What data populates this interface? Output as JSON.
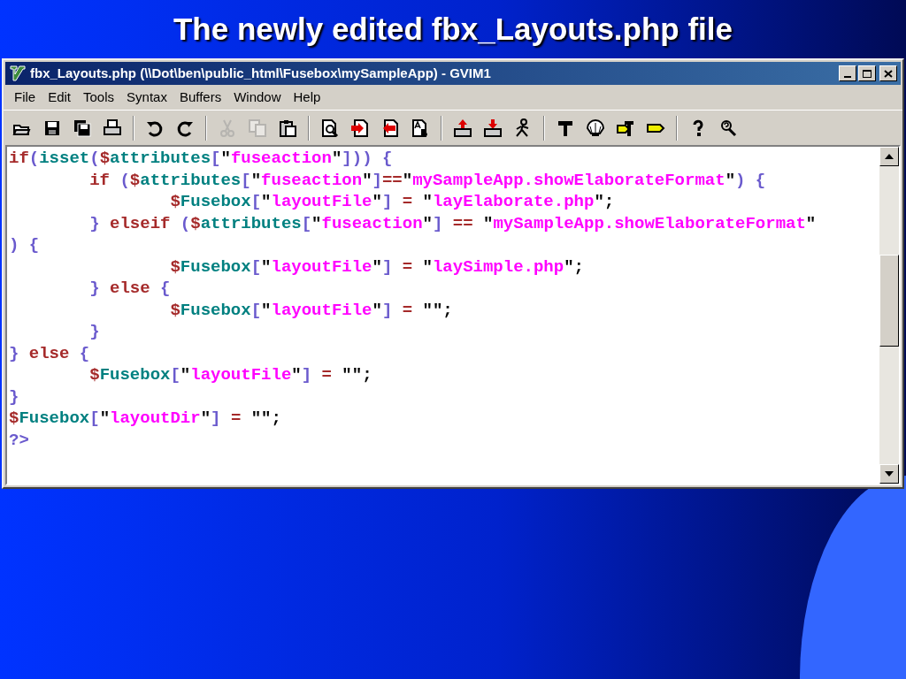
{
  "slide_title": "The newly edited fbx_Layouts.php file",
  "window": {
    "title": "fbx_Layouts.php (\\\\Dot\\ben\\public_html\\Fusebox\\mySampleApp) - GVIM1"
  },
  "menu": [
    "File",
    "Edit",
    "Tools",
    "Syntax",
    "Buffers",
    "Window",
    "Help"
  ],
  "toolbar": [
    {
      "kind": "open",
      "disabled": false
    },
    {
      "kind": "save",
      "disabled": false
    },
    {
      "kind": "saveall",
      "disabled": false
    },
    {
      "kind": "print",
      "disabled": false
    },
    {
      "kind": "sep"
    },
    {
      "kind": "undo",
      "disabled": false
    },
    {
      "kind": "redo",
      "disabled": false
    },
    {
      "kind": "sep"
    },
    {
      "kind": "cut",
      "disabled": true
    },
    {
      "kind": "copy",
      "disabled": true
    },
    {
      "kind": "paste",
      "disabled": false
    },
    {
      "kind": "sep"
    },
    {
      "kind": "find",
      "disabled": false
    },
    {
      "kind": "findnext",
      "disabled": false
    },
    {
      "kind": "findprev",
      "disabled": false
    },
    {
      "kind": "replace",
      "disabled": false
    },
    {
      "kind": "sep"
    },
    {
      "kind": "load",
      "disabled": false
    },
    {
      "kind": "store",
      "disabled": false
    },
    {
      "kind": "run",
      "disabled": false
    },
    {
      "kind": "sep"
    },
    {
      "kind": "make",
      "disabled": false
    },
    {
      "kind": "shell",
      "disabled": false
    },
    {
      "kind": "tagjump",
      "disabled": false
    },
    {
      "kind": "tag",
      "disabled": false
    },
    {
      "kind": "sep"
    },
    {
      "kind": "help",
      "disabled": false
    },
    {
      "kind": "findhelp",
      "disabled": false
    }
  ],
  "code": [
    [
      {
        "kind": "kw",
        "text": "if"
      },
      {
        "kind": "punct",
        "text": "("
      },
      {
        "kind": "fn",
        "text": "isset"
      },
      {
        "kind": "punct",
        "text": "("
      },
      {
        "kind": "kw",
        "text": "$"
      },
      {
        "kind": "fn",
        "text": "attributes"
      },
      {
        "kind": "punct",
        "text": "["
      },
      {
        "kind": "plain",
        "text": "\""
      },
      {
        "kind": "str",
        "text": "fuseaction"
      },
      {
        "kind": "plain",
        "text": "\""
      },
      {
        "kind": "punct",
        "text": "])) {"
      }
    ],
    [
      {
        "kind": "kw",
        "text": "\tif"
      },
      {
        "kind": "punct",
        "text": " ("
      },
      {
        "kind": "kw",
        "text": "$"
      },
      {
        "kind": "fn",
        "text": "attributes"
      },
      {
        "kind": "punct",
        "text": "["
      },
      {
        "kind": "plain",
        "text": "\""
      },
      {
        "kind": "str",
        "text": "fuseaction"
      },
      {
        "kind": "plain",
        "text": "\""
      },
      {
        "kind": "punct",
        "text": "]"
      },
      {
        "kind": "op",
        "text": "=="
      },
      {
        "kind": "plain",
        "text": "\""
      },
      {
        "kind": "str",
        "text": "mySampleApp.showElaborateFormat"
      },
      {
        "kind": "plain",
        "text": "\""
      },
      {
        "kind": "punct",
        "text": ") {"
      }
    ],
    [
      {
        "kind": "kw",
        "text": "\t\t$"
      },
      {
        "kind": "fn",
        "text": "Fusebox"
      },
      {
        "kind": "punct",
        "text": "["
      },
      {
        "kind": "plain",
        "text": "\""
      },
      {
        "kind": "str",
        "text": "layoutFile"
      },
      {
        "kind": "plain",
        "text": "\""
      },
      {
        "kind": "punct",
        "text": "]"
      },
      {
        "kind": "op",
        "text": " = "
      },
      {
        "kind": "plain",
        "text": "\""
      },
      {
        "kind": "str",
        "text": "layElaborate.php"
      },
      {
        "kind": "plain",
        "text": "\";"
      }
    ],
    [
      {
        "kind": "punct",
        "text": "\t} "
      },
      {
        "kind": "kw",
        "text": "elseif"
      },
      {
        "kind": "punct",
        "text": " ("
      },
      {
        "kind": "kw",
        "text": "$"
      },
      {
        "kind": "fn",
        "text": "attributes"
      },
      {
        "kind": "punct",
        "text": "["
      },
      {
        "kind": "plain",
        "text": "\""
      },
      {
        "kind": "str",
        "text": "fuseaction"
      },
      {
        "kind": "plain",
        "text": "\""
      },
      {
        "kind": "punct",
        "text": "]"
      },
      {
        "kind": "op",
        "text": " == "
      },
      {
        "kind": "plain",
        "text": "\""
      },
      {
        "kind": "str",
        "text": "mySampleApp.showElaborateFormat"
      },
      {
        "kind": "plain",
        "text": "\""
      }
    ],
    [
      {
        "kind": "punct",
        "text": ") {"
      }
    ],
    [
      {
        "kind": "kw",
        "text": "\t\t$"
      },
      {
        "kind": "fn",
        "text": "Fusebox"
      },
      {
        "kind": "punct",
        "text": "["
      },
      {
        "kind": "plain",
        "text": "\""
      },
      {
        "kind": "str",
        "text": "layoutFile"
      },
      {
        "kind": "plain",
        "text": "\""
      },
      {
        "kind": "punct",
        "text": "]"
      },
      {
        "kind": "op",
        "text": " = "
      },
      {
        "kind": "plain",
        "text": "\""
      },
      {
        "kind": "str",
        "text": "laySimple.php"
      },
      {
        "kind": "plain",
        "text": "\";"
      }
    ],
    [
      {
        "kind": "punct",
        "text": "\t} "
      },
      {
        "kind": "kw",
        "text": "else"
      },
      {
        "kind": "punct",
        "text": " {"
      }
    ],
    [
      {
        "kind": "kw",
        "text": "\t\t$"
      },
      {
        "kind": "fn",
        "text": "Fusebox"
      },
      {
        "kind": "punct",
        "text": "["
      },
      {
        "kind": "plain",
        "text": "\""
      },
      {
        "kind": "str",
        "text": "layoutFile"
      },
      {
        "kind": "plain",
        "text": "\""
      },
      {
        "kind": "punct",
        "text": "]"
      },
      {
        "kind": "op",
        "text": " = "
      },
      {
        "kind": "plain",
        "text": "\"\";"
      }
    ],
    [
      {
        "kind": "punct",
        "text": "\t}"
      }
    ],
    [
      {
        "kind": "punct",
        "text": "} "
      },
      {
        "kind": "kw",
        "text": "else"
      },
      {
        "kind": "punct",
        "text": " {"
      }
    ],
    [
      {
        "kind": "kw",
        "text": "\t$"
      },
      {
        "kind": "fn",
        "text": "Fusebox"
      },
      {
        "kind": "punct",
        "text": "["
      },
      {
        "kind": "plain",
        "text": "\""
      },
      {
        "kind": "str",
        "text": "layoutFile"
      },
      {
        "kind": "plain",
        "text": "\""
      },
      {
        "kind": "punct",
        "text": "]"
      },
      {
        "kind": "op",
        "text": " = "
      },
      {
        "kind": "plain",
        "text": "\"\";"
      }
    ],
    [
      {
        "kind": "punct",
        "text": "}"
      }
    ],
    [
      {
        "kind": "kw",
        "text": "$"
      },
      {
        "kind": "fn",
        "text": "Fusebox"
      },
      {
        "kind": "punct",
        "text": "["
      },
      {
        "kind": "plain",
        "text": "\""
      },
      {
        "kind": "str",
        "text": "layoutDir"
      },
      {
        "kind": "plain",
        "text": "\""
      },
      {
        "kind": "punct",
        "text": "]"
      },
      {
        "kind": "op",
        "text": " = "
      },
      {
        "kind": "plain",
        "text": "\"\";"
      }
    ],
    [
      {
        "kind": "punct",
        "text": "?>"
      }
    ]
  ]
}
